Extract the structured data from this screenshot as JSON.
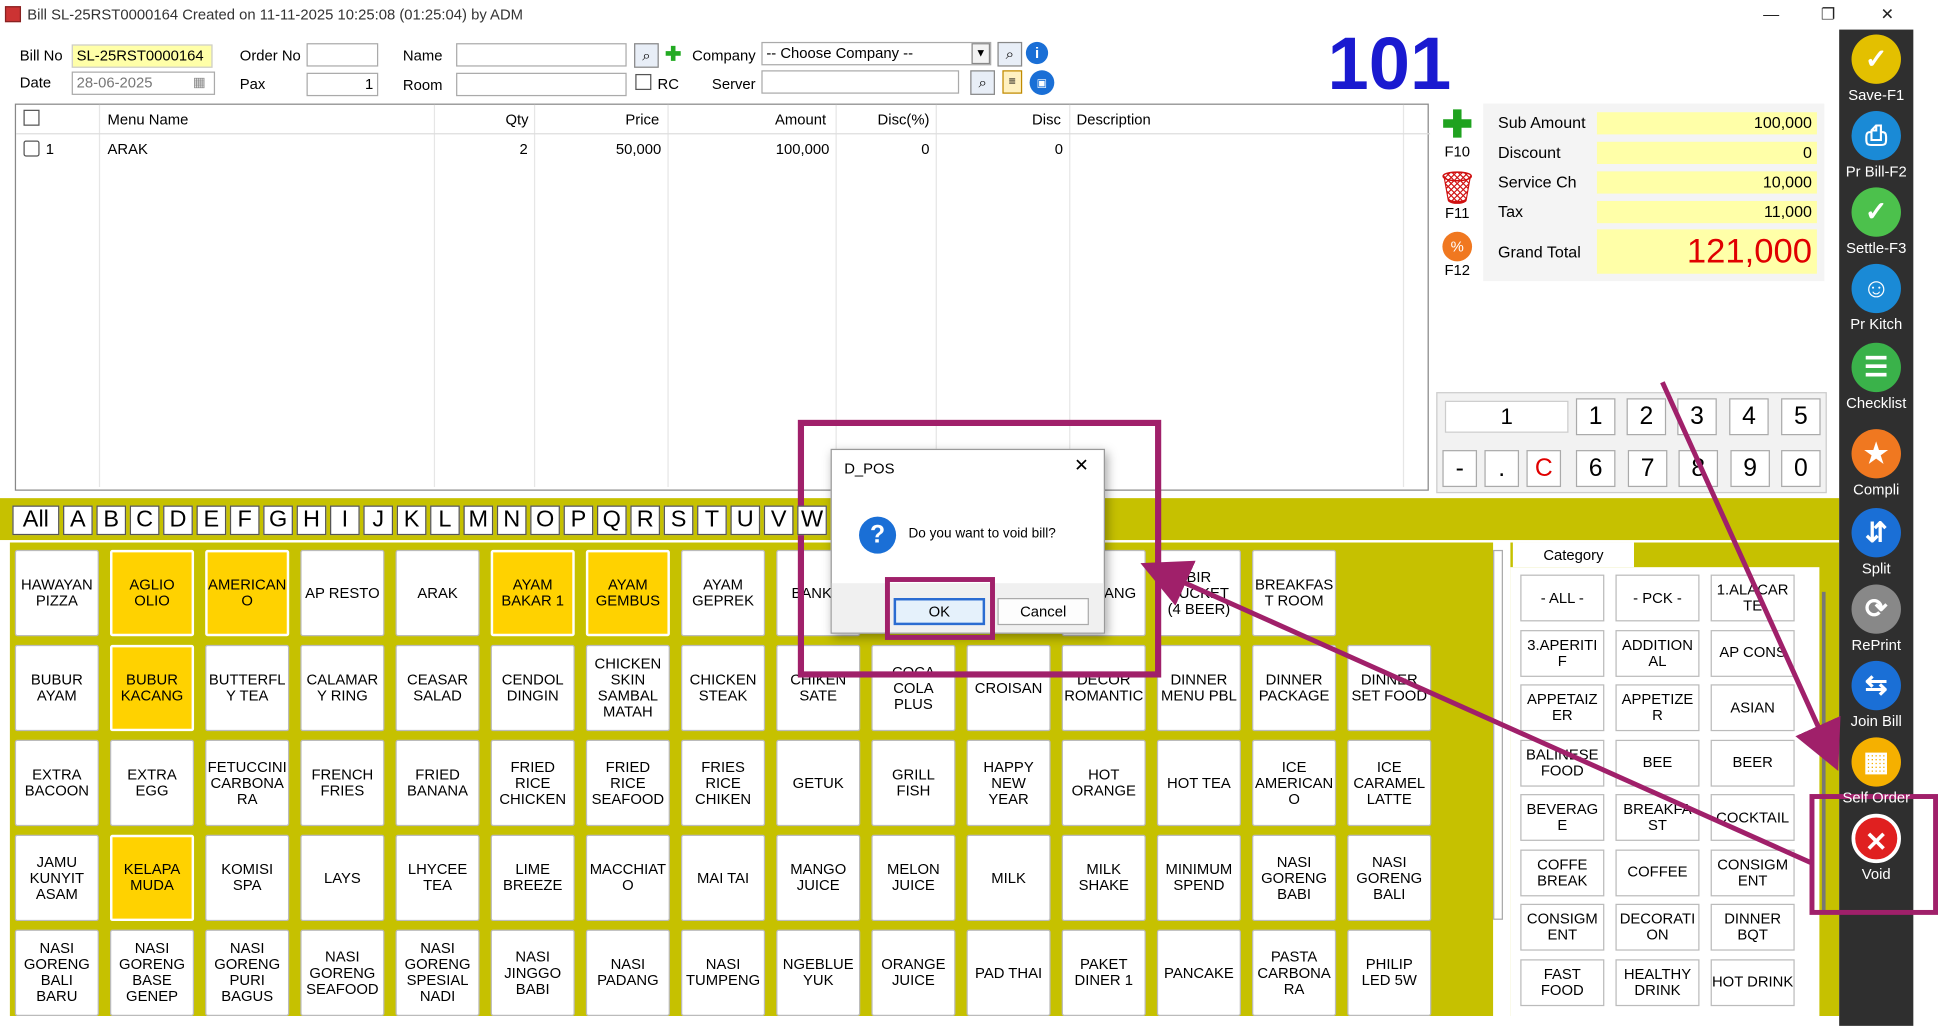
{
  "window": {
    "title": "Bill SL-25RST0000164 Created on 11-11-2025 10:25:08 (01:25:04) by ADM",
    "min": "—",
    "max": "❐",
    "close": "✕"
  },
  "header": {
    "bill_no_label": "Bill No",
    "bill_no": "SL-25RST0000164",
    "order_no_label": "Order No",
    "order_no": "",
    "name_label": "Name",
    "name": "",
    "company_label": "Company",
    "company": "-- Choose Company --",
    "date_label": "Date",
    "date": "28-06-2025",
    "pax_label": "Pax",
    "pax": "1",
    "room_label": "Room",
    "room": "",
    "rc_label": "RC",
    "server_label": "Server",
    "server": "",
    "table_no": "101"
  },
  "grid": {
    "cols": [
      "Menu Name",
      "Qty",
      "Price",
      "Amount",
      "Disc(%)",
      "Disc",
      "Description"
    ],
    "rows": [
      {
        "no": "1",
        "name": "ARAK",
        "qty": "2",
        "price": "50,000",
        "amount": "100,000",
        "discp": "0",
        "disc": "0",
        "desc": ""
      }
    ]
  },
  "actions": {
    "add": "F10",
    "delete": "F11",
    "discount": "F12"
  },
  "totals": {
    "sub_label": "Sub Amount",
    "sub": "100,000",
    "disc_label": "Discount",
    "disc": "0",
    "svc_label": "Service Ch",
    "svc": "10,000",
    "tax_label": "Tax",
    "tax": "11,000",
    "grand_label": "Grand Total",
    "grand": "121,000"
  },
  "numpad": {
    "display": "1",
    "keys1": [
      "1",
      "2",
      "3",
      "4",
      "5"
    ],
    "keys2": [
      "-",
      ".",
      "C",
      "6",
      "7",
      "8",
      "9",
      "0"
    ]
  },
  "sidebar": [
    "Save-F1",
    "Pr Bill-F2",
    "Settle-F3",
    "Pr Kitch",
    "Checklist",
    "Compli",
    "Split",
    "RePrint",
    "Join Bill",
    "Self Order",
    "Void"
  ],
  "alpha": [
    "All",
    "A",
    "B",
    "C",
    "D",
    "E",
    "F",
    "G",
    "H",
    "I",
    "J",
    "K",
    "L",
    "M",
    "N",
    "O",
    "P",
    "Q",
    "R",
    "S",
    "T",
    "U",
    "V",
    "W"
  ],
  "menu": [
    [
      "HAWAYAN PIZZA",
      "AGLIO OLIO",
      "AMERICAN O",
      "AP RESTO",
      "ARAK",
      "AYAM BAKAR 1",
      "AYAM GEMBUS",
      "AYAM GEPREK",
      "BANK F",
      "",
      "",
      "BINTANG",
      "BIR BUCKET (4 BEER)",
      "BREAKFAS T ROOM"
    ],
    [
      "BUBUR AYAM",
      "BUBUR KACANG",
      "BUTTERFL Y TEA",
      "CALAMAR Y RING",
      "CEASAR SALAD",
      "CENDOL DINGIN",
      "CHICKEN SKIN SAMBAL MATAH",
      "CHICKEN STEAK",
      "CHIKEN SATE",
      "COCA COLA PLUS",
      "CROISAN",
      "DECOR ROMANTIC",
      "DINNER MENU PBL",
      "DINNER PACKAGE",
      "DINNER SET FOOD"
    ],
    [
      "EXTRA BACOON",
      "EXTRA EGG",
      "FETUCCINI CARBONA RA",
      "FRENCH FRIES",
      "FRIED BANANA",
      "FRIED RICE CHICKEN",
      "FRIED RICE SEAFOOD",
      "FRIES RICE CHIKEN",
      "GETUK",
      "GRILL FISH",
      "HAPPY NEW YEAR",
      "HOT ORANGE",
      "HOT TEA",
      "ICE AMERICAN O",
      "ICE CARAMEL LATTE"
    ],
    [
      "JAMU KUNYIT ASAM",
      "KELAPA MUDA",
      "KOMISI SPA",
      "LAYS",
      "LHYCEE TEA",
      "LIME BREEZE",
      "MACCHIAT O",
      "MAI TAI",
      "MANGO JUICE",
      "MELON JUICE",
      "MILK",
      "MILK SHAKE",
      "MINIMUM SPEND",
      "NASI GORENG BABI",
      "NASI GORENG BALI"
    ],
    [
      "NASI GORENG BALI BARU",
      "NASI GORENG BASE GENEP",
      "NASI GORENG PURI BAGUS",
      "NASI GORENG SEAFOOD",
      "NASI GORENG SPESIAL NADI",
      "NASI JINGGO BABI",
      "NASI PADANG",
      "NASI TUMPENG",
      "NGEBLUE YUK",
      "ORANGE JUICE",
      "PAD THAI",
      "PAKET DINER 1",
      "PANCAKE",
      "PASTA CARBONA RA",
      "PHILIP LED 5W"
    ]
  ],
  "category": {
    "tab": "Category",
    "items": [
      "- ALL -",
      "- PCK -",
      "1.ALACAR TE",
      "3.APERITI F",
      "ADDITION AL",
      "AP CONS",
      "APPETAIZ ER",
      "APPETIZE R",
      "ASIAN",
      "BALINESE FOOD",
      "BEE",
      "BEER",
      "BEVERAG E",
      "BREAKFA ST",
      "COCKTAIL",
      "COFFE BREAK",
      "COFFEE",
      "CONSIGM ENT",
      "CONSIGM ENT",
      "DECORATI ON",
      "DINNER BQT",
      "FAST FOOD",
      "HEALTHY DRINK",
      "HOT DRINK"
    ]
  },
  "dialog": {
    "title": "D_POS",
    "message": "Do you want to void bill?",
    "ok": "OK",
    "cancel": "Cancel",
    "close": "✕"
  },
  "colors": {
    "accent": "#1a1ad0",
    "highlight": "#ffd200",
    "menu_bg": "#c6c100",
    "sidebar": "#2f2f2f",
    "annotation": "#a0206a"
  }
}
